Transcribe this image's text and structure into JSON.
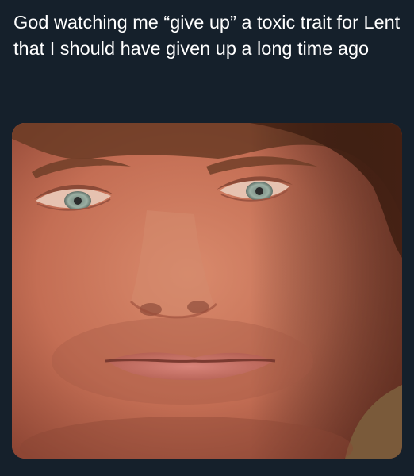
{
  "post": {
    "caption": "God watching me “give up” a toxic trait for Lent that I should have given up a long time ago"
  },
  "image": {
    "subject": "close-up face",
    "colors": {
      "background": "#15202b",
      "skin": "#c8745a",
      "hair": "#5a3420",
      "eye": "#8fa49a"
    }
  }
}
